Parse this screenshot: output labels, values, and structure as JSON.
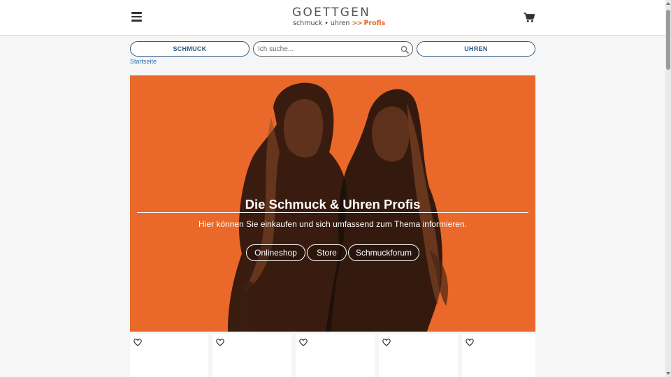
{
  "header": {
    "logo": {
      "wordmark": "GOETTGEN",
      "tagline_left": "schmuck • uhren",
      "tagline_arrows": ">>",
      "tagline_right": "Profis"
    },
    "icons": {
      "menu": "hamburger-menu-icon",
      "cart": "shopping-cart-icon"
    }
  },
  "nav": {
    "schmuck_label": "SCHMUCK",
    "uhren_label": "UHREN",
    "search_placeholder": "Ich suche...",
    "search_value": ""
  },
  "breadcrumb": {
    "home": "Startseite"
  },
  "hero": {
    "title": "Die Schmuck & Uhren Profis",
    "subtitle": "Hier können Sie einkaufen und sich umfassend zum Thema informieren.",
    "buttons": [
      "Onlineshop",
      "Store",
      "Schmuckforum"
    ]
  },
  "colors": {
    "brand_orange": "#e9682a",
    "nav_blue": "#2c5a86",
    "link_blue": "#2e6fb0"
  }
}
